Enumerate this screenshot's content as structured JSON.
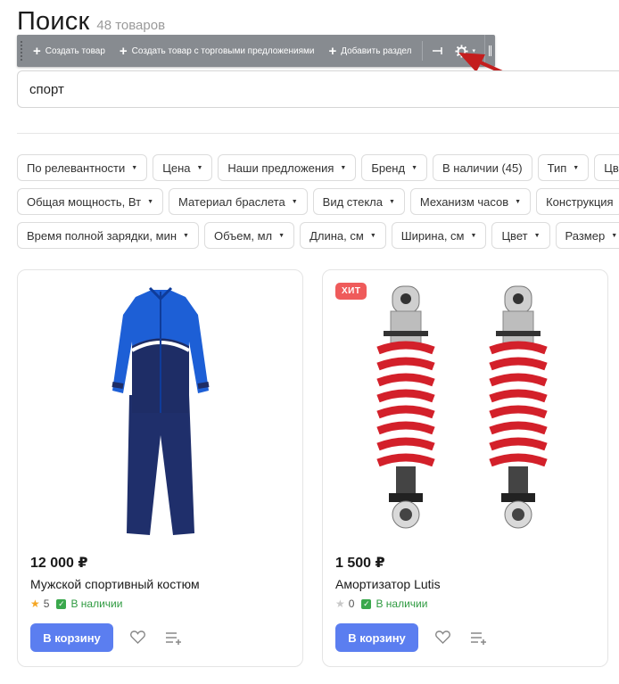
{
  "header": {
    "title": "Поиск",
    "count": "48 товаров"
  },
  "admin_bar": {
    "buttons": [
      {
        "label": "Создать товар"
      },
      {
        "label": "Создать товар с торговыми предложениями"
      },
      {
        "label": "Добавить раздел"
      }
    ]
  },
  "search": {
    "value": "спорт"
  },
  "filters": {
    "row1": [
      "По релевантности",
      "Цена",
      "Наши предложения",
      "Бренд",
      "В наличии (45)",
      "Тип",
      "Цв"
    ],
    "row2": [
      "Общая мощность, Вт",
      "Материал браслета",
      "Вид стекла",
      "Механизм часов",
      "Конструкция"
    ],
    "row3": [
      "Время полной зарядки, мин",
      "Объем, мл",
      "Длина, см",
      "Ширина, см",
      "Цвет",
      "Размер"
    ]
  },
  "products": [
    {
      "badge": "",
      "price": "12 000 ₽",
      "name": "Мужской спортивный костюм",
      "rating": "5",
      "stock": "В наличии",
      "cart_label": "В корзину"
    },
    {
      "badge": "ХИТ",
      "price": "1 500 ₽",
      "name": "Амортизатор Lutis",
      "rating": "0",
      "stock": "В наличии",
      "cart_label": "В корзину"
    }
  ],
  "colors": {
    "accent": "#5b7ef0",
    "badge": "#ef5b5b",
    "in_stock": "#2e9a40",
    "star_active": "#f5a623",
    "star_inactive": "#c8c8c8"
  }
}
